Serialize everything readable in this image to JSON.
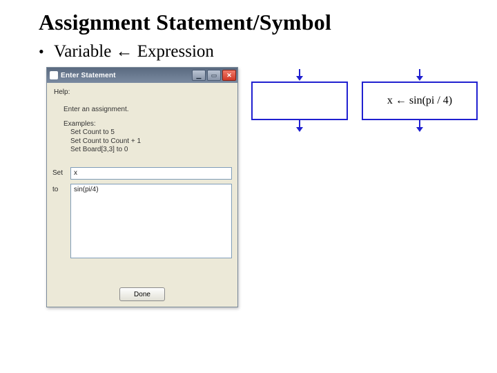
{
  "slide": {
    "title": "Assignment Statement/Symbol",
    "bullet1_dot": "•",
    "bullet1_text": "Variable ← Expression"
  },
  "dialog": {
    "title": "Enter Statement",
    "help_label": "Help:",
    "help_intro": "Enter an assignment.",
    "examples_label": "Examples:",
    "ex1": "Set Count to 5",
    "ex2": "Set Count to Count + 1",
    "ex3": "Set Board[3,3] to 0",
    "set_label": "Set",
    "to_label": "to",
    "set_value": "x",
    "to_value": "sin(pi/4)",
    "done_label": "Done"
  },
  "winbtns": {
    "min": "▁",
    "max": "▭",
    "close": "✕"
  },
  "flow": {
    "box_empty": "",
    "box_expr": "x ← sin(pi / 4)"
  }
}
